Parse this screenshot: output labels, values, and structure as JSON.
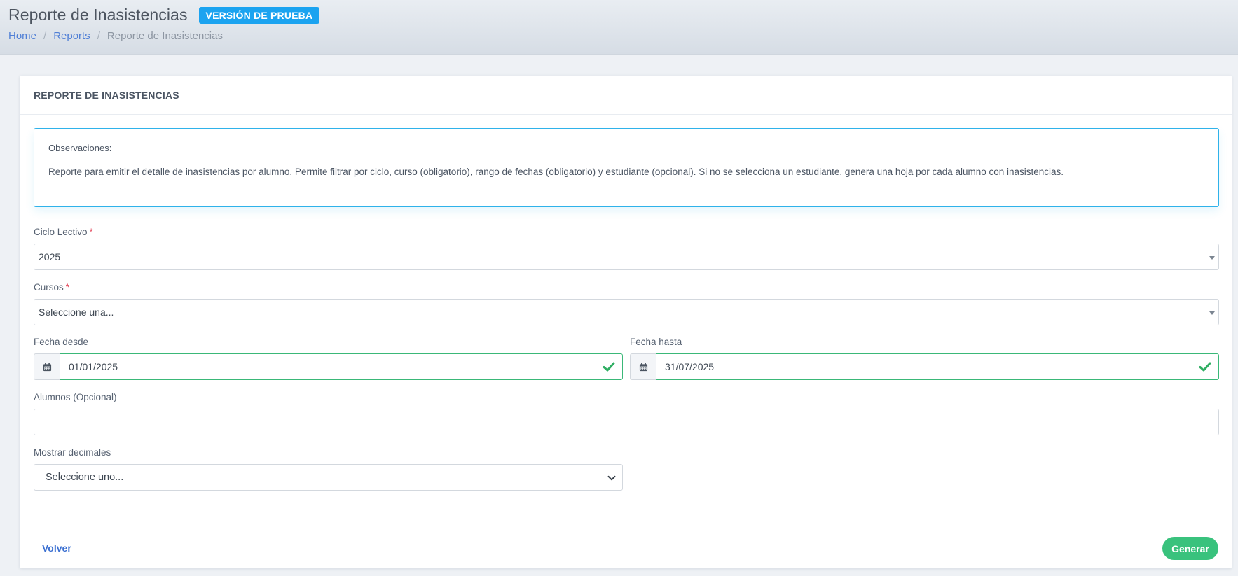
{
  "header": {
    "title": "Reporte de Inasistencias",
    "badge": "VERSIÓN DE PRUEBA",
    "breadcrumb": [
      {
        "label": "Home"
      },
      {
        "label": "Reports"
      },
      {
        "label": "Reporte de Inasistencias"
      }
    ],
    "separator": "/"
  },
  "card": {
    "title": "REPORTE DE INASISTENCIAS",
    "info": {
      "title": "Observaciones:",
      "text": "Reporte para emitir el detalle de inasistencias por alumno. Permite filtrar por ciclo, curso (obligatorio), rango de fechas (obligatorio) y estudiante (opcional). Si no se selecciona un estudiante, genera una hoja por cada alumno con inasistencias."
    },
    "form": {
      "ciclo": {
        "label": "Ciclo Lectivo",
        "required_mark": "*",
        "value": "2025"
      },
      "cursos": {
        "label": "Cursos",
        "required_mark": "*",
        "value": "Seleccione una..."
      },
      "fecha_desde": {
        "label": "Fecha desde",
        "value": "01/01/2025",
        "icon": "calendar-icon",
        "valid": true
      },
      "fecha_hasta": {
        "label": "Fecha hasta",
        "value": "31/07/2025",
        "icon": "calendar-icon",
        "valid": true
      },
      "alumnos": {
        "label": "Alumnos (Opcional)",
        "value": ""
      },
      "decimales": {
        "label": "Mostrar decimales",
        "value": "Seleccione uno..."
      }
    },
    "footer": {
      "back_label": "Volver",
      "generate_label": "Generar"
    }
  },
  "colors": {
    "badge": "#1ba3f0",
    "info_border": "#2fb2ea",
    "valid_border": "#3ab878",
    "generate_button": "#39c27d",
    "link": "#4f7fd6",
    "required": "#e3465a"
  }
}
